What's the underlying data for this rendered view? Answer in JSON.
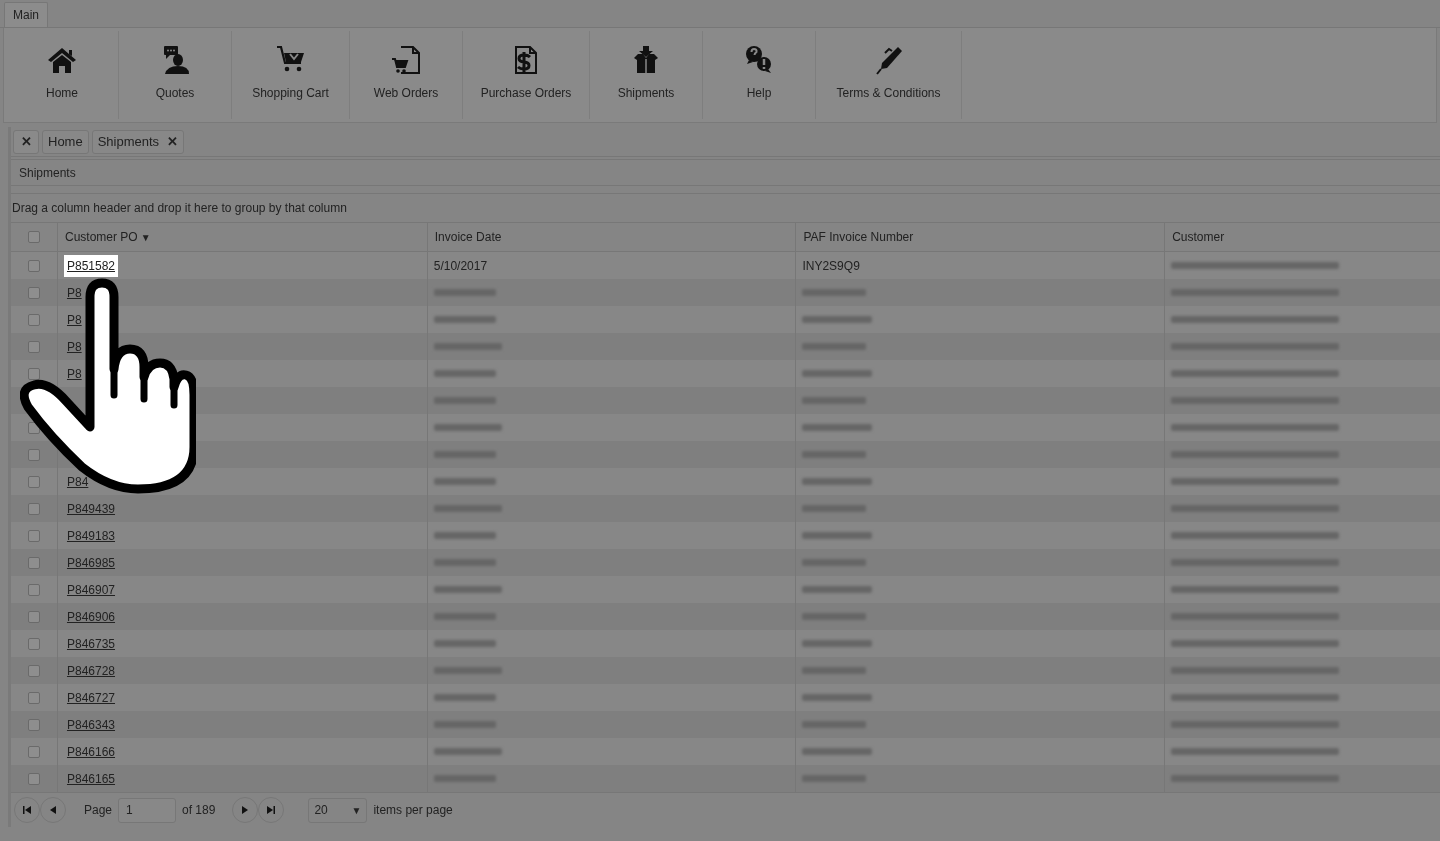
{
  "ribbon_tab": {
    "label": "Main"
  },
  "ribbon_items": [
    {
      "kind": "home",
      "label": "Home"
    },
    {
      "kind": "quotes",
      "label": "Quotes"
    },
    {
      "kind": "cart",
      "label": "Shopping Cart"
    },
    {
      "kind": "web",
      "label": "Web Orders"
    },
    {
      "kind": "dollar",
      "label": "Purchase Orders"
    },
    {
      "kind": "box",
      "label": "Shipments"
    },
    {
      "kind": "help",
      "label": "Help"
    },
    {
      "kind": "pen",
      "label": "Terms & Conditions"
    }
  ],
  "close_all": "✕",
  "tabs": [
    {
      "label": "Home"
    },
    {
      "label": "Shipments",
      "close": "✕"
    }
  ],
  "panel_title": "Shipments",
  "group_hint": "Drag a column header and drop it here to group by that column",
  "table": {
    "header_checked": false,
    "columns": [
      {
        "label": "Customer PO",
        "sort": "▼"
      },
      {
        "label": "Invoice Date"
      },
      {
        "label": "PAF Invoice Number"
      },
      {
        "label": "Customer"
      }
    ],
    "rows": [
      {
        "checked": false,
        "highlighted": true,
        "po": "P851582",
        "invoice_date": "5/10/2017",
        "paf_invoice": "INY2S9Q9"
      },
      {
        "checked": false,
        "highlighted": false,
        "po": "P8"
      },
      {
        "checked": false,
        "highlighted": false,
        "po": "P8"
      },
      {
        "checked": false,
        "highlighted": false,
        "po": "P8"
      },
      {
        "checked": false,
        "highlighted": false,
        "po": "P8"
      },
      {},
      {
        "checked": false
      },
      {
        "checked": false
      },
      {
        "checked": false,
        "po": "P84"
      },
      {
        "checked": false,
        "highlighted": false,
        "po": "P849439"
      },
      {
        "checked": false,
        "highlighted": false,
        "po": "P849183"
      },
      {
        "checked": false,
        "highlighted": false,
        "po": "P846985"
      },
      {
        "checked": false,
        "highlighted": false,
        "po": "P846907"
      },
      {
        "checked": false,
        "highlighted": false,
        "po": "P846906"
      },
      {
        "checked": false,
        "highlighted": false,
        "po": "P846735"
      },
      {
        "checked": false,
        "highlighted": false,
        "po": "P846728"
      },
      {
        "checked": false,
        "highlighted": false,
        "po": "P846727"
      },
      {
        "checked": false,
        "highlighted": false,
        "po": "P846343"
      },
      {
        "checked": false,
        "highlighted": false,
        "po": "P846166"
      },
      {
        "checked": false,
        "highlighted": false,
        "po": "P846165"
      }
    ]
  },
  "pager": {
    "page_label": "Page",
    "page": "1",
    "of": "of 189",
    "page_size": "20",
    "page_size_caret": "▼",
    "per_page_label": "items per page"
  }
}
